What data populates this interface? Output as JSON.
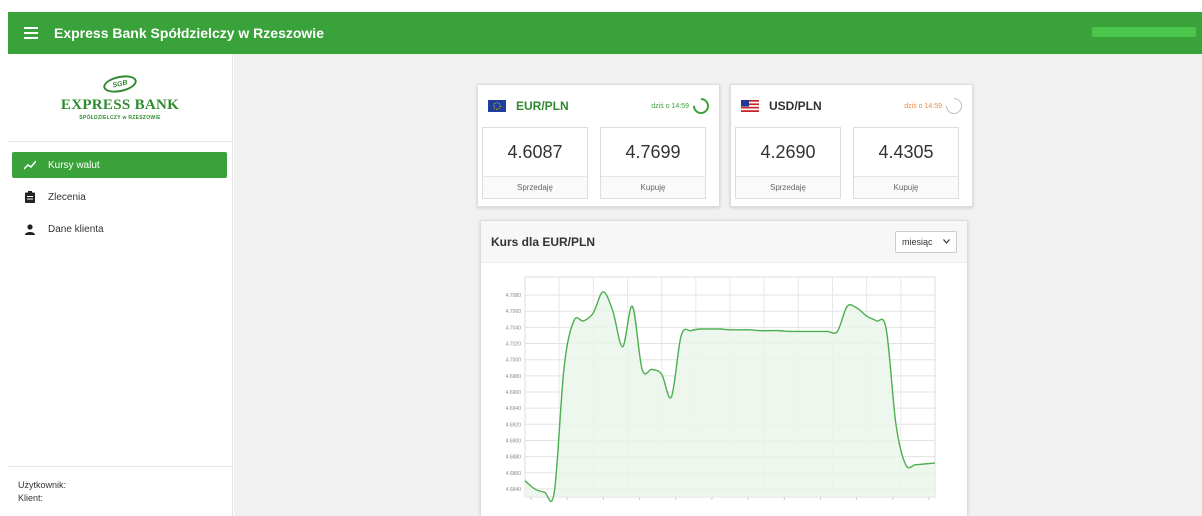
{
  "header": {
    "title": "Express Bank Spółdzielczy w Rzeszowie"
  },
  "logo": {
    "badge": "SGB",
    "main": "EXPRESS BANK",
    "sub": "SPÓŁDZIELCZY w RZESZOWIE"
  },
  "sidebar": {
    "items": [
      {
        "label": "Kursy walut",
        "icon": "trend-icon",
        "active": true
      },
      {
        "label": "Zlecenia",
        "icon": "clipboard-icon",
        "active": false
      },
      {
        "label": "Dane klienta",
        "icon": "person-icon",
        "active": false
      }
    ],
    "footer": {
      "user_label": "Użytkownik:",
      "client_label": "Klient:"
    }
  },
  "cards": [
    {
      "pair": "EUR/PLN",
      "updated": "dziś o 14:59",
      "sell": "4.6087",
      "sell_label": "Sprzedaję",
      "buy": "4.7699",
      "buy_label": "Kupuję"
    },
    {
      "pair": "USD/PLN",
      "updated": "dziś o 14:59",
      "sell": "4.2690",
      "sell_label": "Sprzedaję",
      "buy": "4.4305",
      "buy_label": "Kupuję"
    }
  ],
  "chart_section": {
    "title": "Kurs dla EUR/PLN",
    "period": "miesiąc"
  },
  "chart_data": {
    "type": "area",
    "y_ticks": [
      "4.7080",
      "4.7060",
      "4.7040",
      "4.7020",
      "4.7000",
      "4.6980",
      "4.6960",
      "4.6940",
      "4.6920",
      "4.6900",
      "4.6880",
      "4.6860",
      "4.6840"
    ],
    "ylim": [
      4.683,
      4.709
    ],
    "x": [
      0,
      1,
      2,
      3,
      4,
      5,
      6,
      7,
      8,
      9,
      10,
      11,
      12,
      13,
      14,
      15,
      16,
      17,
      18,
      19,
      20,
      21,
      22,
      23,
      24,
      25,
      26,
      27,
      28,
      29,
      30,
      31,
      32,
      33,
      34,
      35,
      36,
      37,
      38,
      39,
      40,
      41,
      42,
      43,
      44,
      45,
      46,
      47,
      48,
      49,
      50
    ],
    "values": [
      4.685,
      4.684,
      4.6836,
      4.6836,
      4.699,
      4.7048,
      4.7048,
      4.7058,
      4.7084,
      4.706,
      4.7016,
      4.7066,
      4.6988,
      4.6988,
      4.6982,
      4.6954,
      4.703,
      4.7036,
      4.7038,
      4.7038,
      4.7038,
      4.7037,
      4.7037,
      4.7037,
      4.7036,
      4.7036,
      4.7036,
      4.7035,
      4.7035,
      4.7035,
      4.7035,
      4.7035,
      4.7035,
      4.7066,
      4.7064,
      4.7054,
      4.7048,
      4.7038,
      4.692,
      4.687,
      4.687,
      4.6871,
      4.6872
    ],
    "line_color": "#4caf50",
    "fill_color": "#e8f5e9",
    "grid": true
  }
}
